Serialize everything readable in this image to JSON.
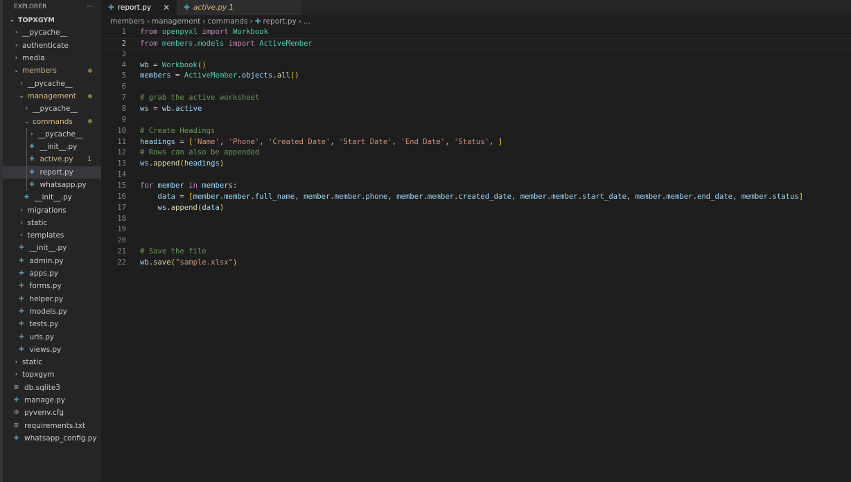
{
  "sidebar": {
    "title": "EXPLORER",
    "more": "···",
    "root": "TOPXGYM",
    "items": [
      {
        "d": 1,
        "t": "dir",
        "l": "__pycache__"
      },
      {
        "d": 1,
        "t": "dir",
        "l": "authenticate"
      },
      {
        "d": 1,
        "t": "dir",
        "l": "media"
      },
      {
        "d": 1,
        "t": "open",
        "l": "members",
        "c": "#d7ba7d",
        "dot": true
      },
      {
        "d": 2,
        "t": "dir",
        "l": "__pycache__"
      },
      {
        "d": 2,
        "t": "open",
        "l": "management",
        "c": "#d7ba7d",
        "dot": true
      },
      {
        "d": 3,
        "t": "dir",
        "l": "__pycache__"
      },
      {
        "d": 3,
        "t": "open",
        "l": "commands",
        "c": "#d7ba7d",
        "dot": true
      },
      {
        "d": 4,
        "t": "dir",
        "l": "__pycache__"
      },
      {
        "d": 4,
        "t": "py",
        "l": "__init__.py"
      },
      {
        "d": 4,
        "t": "py",
        "l": "active.py",
        "c": "#d7ba7d",
        "badge": "1"
      },
      {
        "d": 4,
        "t": "py",
        "l": "report.py",
        "sel": true
      },
      {
        "d": 4,
        "t": "py",
        "l": "whatsapp.py"
      },
      {
        "d": 3,
        "t": "py",
        "l": "__init__.py"
      },
      {
        "d": 2,
        "t": "dir",
        "l": "migrations"
      },
      {
        "d": 2,
        "t": "dir",
        "l": "static"
      },
      {
        "d": 2,
        "t": "dir",
        "l": "templates"
      },
      {
        "d": 2,
        "t": "py",
        "l": "__init__.py"
      },
      {
        "d": 2,
        "t": "py",
        "l": "admin.py"
      },
      {
        "d": 2,
        "t": "py",
        "l": "apps.py"
      },
      {
        "d": 2,
        "t": "py",
        "l": "forms.py"
      },
      {
        "d": 2,
        "t": "py",
        "l": "helper.py"
      },
      {
        "d": 2,
        "t": "py",
        "l": "models.py"
      },
      {
        "d": 2,
        "t": "py",
        "l": "tests.py"
      },
      {
        "d": 2,
        "t": "py",
        "l": "urls.py"
      },
      {
        "d": 2,
        "t": "py",
        "l": "views.py"
      },
      {
        "d": 1,
        "t": "dir",
        "l": "static"
      },
      {
        "d": 1,
        "t": "dir",
        "l": "topxgym"
      },
      {
        "d": 1,
        "t": "txt",
        "l": "db.sqlite3"
      },
      {
        "d": 1,
        "t": "py",
        "l": "manage.py"
      },
      {
        "d": 1,
        "t": "gear",
        "l": "pyvenv.cfg"
      },
      {
        "d": 1,
        "t": "txt",
        "l": "requirements.txt"
      },
      {
        "d": 1,
        "t": "py",
        "l": "whatsapp_config.py"
      }
    ]
  },
  "tabs": [
    {
      "label": "report.py",
      "active": true,
      "close": "✕"
    },
    {
      "label": "active.py 1",
      "active": false
    }
  ],
  "breadcrumb": [
    "members",
    "management",
    "commands",
    "report.py",
    "..."
  ],
  "code": [
    [
      [
        "from",
        "kw"
      ],
      [
        " ",
        "p"
      ],
      [
        "openpyxl",
        "cls"
      ],
      [
        " ",
        "p"
      ],
      [
        "import",
        "kw"
      ],
      [
        " ",
        "p"
      ],
      [
        "Workbook",
        "cls"
      ]
    ],
    [
      [
        "from",
        "kw"
      ],
      [
        " ",
        "p"
      ],
      [
        "members",
        "cls"
      ],
      [
        ".",
        "p"
      ],
      [
        "models",
        "cls"
      ],
      [
        " ",
        "p"
      ],
      [
        "import",
        "kw"
      ],
      [
        " ",
        "p"
      ],
      [
        "ActiveMember",
        "cls"
      ]
    ],
    [],
    [
      [
        "wb",
        "var"
      ],
      [
        " = ",
        "p"
      ],
      [
        "Workbook",
        "cls"
      ],
      [
        "()",
        "br"
      ]
    ],
    [
      [
        "members",
        "var"
      ],
      [
        " = ",
        "p"
      ],
      [
        "ActiveMember",
        "cls"
      ],
      [
        ".",
        "p"
      ],
      [
        "objects",
        "var"
      ],
      [
        ".",
        "p"
      ],
      [
        "all",
        "fn"
      ],
      [
        "()",
        "br"
      ]
    ],
    [],
    [
      [
        "# grab the active worksheet",
        "cm"
      ]
    ],
    [
      [
        "ws",
        "var"
      ],
      [
        " = ",
        "p"
      ],
      [
        "wb",
        "var"
      ],
      [
        ".",
        "p"
      ],
      [
        "active",
        "var"
      ]
    ],
    [],
    [
      [
        "# Create Headings",
        "cm"
      ]
    ],
    [
      [
        "headings",
        "var"
      ],
      [
        " = ",
        "p"
      ],
      [
        "[",
        "br"
      ],
      [
        "'Name'",
        "str"
      ],
      [
        ", ",
        "p"
      ],
      [
        "'Phone'",
        "str"
      ],
      [
        ", ",
        "p"
      ],
      [
        "'Created Date'",
        "str"
      ],
      [
        ", ",
        "p"
      ],
      [
        "'Start Date'",
        "str"
      ],
      [
        ", ",
        "p"
      ],
      [
        "'End Date'",
        "str"
      ],
      [
        ", ",
        "p"
      ],
      [
        "'Status'",
        "str"
      ],
      [
        ", ",
        "p"
      ],
      [
        "]",
        "br"
      ]
    ],
    [
      [
        "# Rows can also be appended",
        "cm"
      ]
    ],
    [
      [
        "ws",
        "var"
      ],
      [
        ".",
        "p"
      ],
      [
        "append",
        "fn"
      ],
      [
        "(",
        "br"
      ],
      [
        "headings",
        "var"
      ],
      [
        ")",
        "br"
      ]
    ],
    [],
    [
      [
        "for",
        "kw"
      ],
      [
        " ",
        "p"
      ],
      [
        "member",
        "var"
      ],
      [
        " ",
        "p"
      ],
      [
        "in",
        "kw"
      ],
      [
        " ",
        "p"
      ],
      [
        "members",
        "var"
      ],
      [
        ":",
        "p"
      ]
    ],
    [
      [
        "    ",
        "p"
      ],
      [
        "data",
        "var"
      ],
      [
        " = ",
        "p"
      ],
      [
        "[",
        "br"
      ],
      [
        "member",
        "var"
      ],
      [
        ".",
        "p"
      ],
      [
        "member",
        "var"
      ],
      [
        ".",
        "p"
      ],
      [
        "full_name",
        "var"
      ],
      [
        ", ",
        "p"
      ],
      [
        "member",
        "var"
      ],
      [
        ".",
        "p"
      ],
      [
        "member",
        "var"
      ],
      [
        ".",
        "p"
      ],
      [
        "phone",
        "var"
      ],
      [
        ", ",
        "p"
      ],
      [
        "member",
        "var"
      ],
      [
        ".",
        "p"
      ],
      [
        "member",
        "var"
      ],
      [
        ".",
        "p"
      ],
      [
        "created_date",
        "var"
      ],
      [
        ", ",
        "p"
      ],
      [
        "member",
        "var"
      ],
      [
        ".",
        "p"
      ],
      [
        "member",
        "var"
      ],
      [
        ".",
        "p"
      ],
      [
        "start_date",
        "var"
      ],
      [
        ", ",
        "p"
      ],
      [
        "member",
        "var"
      ],
      [
        ".",
        "p"
      ],
      [
        "member",
        "var"
      ],
      [
        ".",
        "p"
      ],
      [
        "end_date",
        "var"
      ],
      [
        ", ",
        "p"
      ],
      [
        "member",
        "var"
      ],
      [
        ".",
        "p"
      ],
      [
        "status",
        "var"
      ],
      [
        "]",
        "br"
      ]
    ],
    [
      [
        "    ",
        "p"
      ],
      [
        "ws",
        "var"
      ],
      [
        ".",
        "p"
      ],
      [
        "append",
        "fn"
      ],
      [
        "(",
        "br"
      ],
      [
        "data",
        "var"
      ],
      [
        ")",
        "br"
      ]
    ],
    [],
    [],
    [],
    [
      [
        "# Save the file",
        "cm"
      ]
    ],
    [
      [
        "wb",
        "var"
      ],
      [
        ".",
        "p"
      ],
      [
        "save",
        "fn"
      ],
      [
        "(",
        "br"
      ],
      [
        "\"sample.xlsx\"",
        "str"
      ],
      [
        ")",
        "br"
      ]
    ]
  ],
  "current_line": 2
}
